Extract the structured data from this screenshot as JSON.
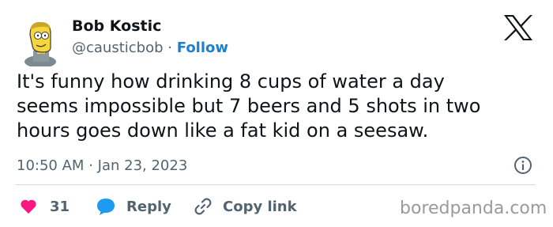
{
  "author": {
    "name": "Bob Kostic",
    "handle": "@causticbob",
    "separator": "·",
    "follow_label": "Follow",
    "avatar_icon": "cartoon-avatar-icon"
  },
  "platform_logo": "x-logo-icon",
  "tweet": {
    "lines": [
      "It's funny how drinking 8 cups of water a day",
      "seems impossible but 7 beers and 5 shots in two",
      "hours goes down like a fat kid on a seesaw."
    ]
  },
  "timestamp": {
    "time": "10:50 AM",
    "separator": "·",
    "date": "Jan 23, 2023"
  },
  "info_icon": "info-icon",
  "actions": {
    "like": {
      "icon": "heart-icon",
      "count": "31",
      "color": "#f91880"
    },
    "reply": {
      "icon": "speech-bubble-icon",
      "label": "Reply",
      "color": "#1d9bf0"
    },
    "copy_link": {
      "icon": "link-icon",
      "label": "Copy link"
    }
  },
  "watermark": "boredpanda.com",
  "colors": {
    "text": "#0f1419",
    "secondary": "#536471",
    "follow": "#1d7fcf",
    "divider": "#d4dbe0"
  }
}
